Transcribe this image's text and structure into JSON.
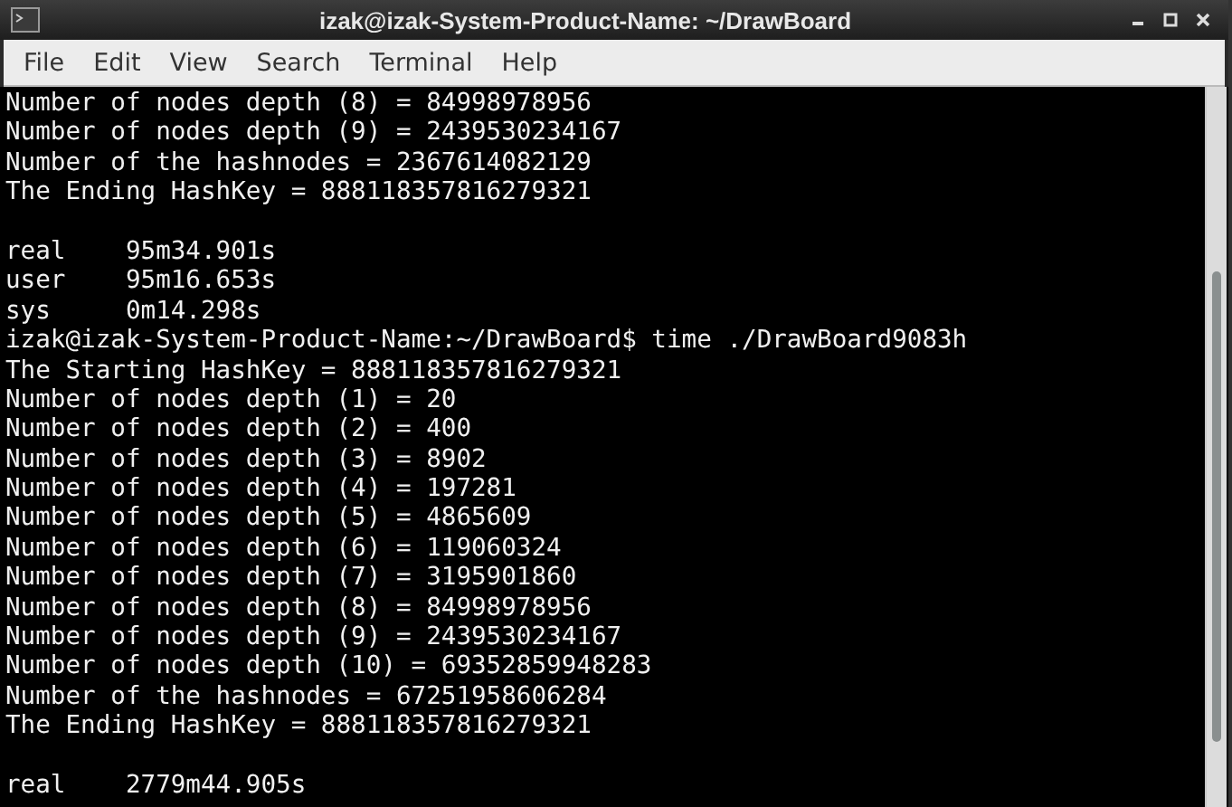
{
  "window": {
    "title": "izak@izak-System-Product-Name: ~/DrawBoard"
  },
  "menu": [
    "File",
    "Edit",
    "View",
    "Search",
    "Terminal",
    "Help"
  ],
  "terminal": {
    "lines": [
      {
        "kind": "text",
        "text": "Number of nodes depth (8) = 84998978956"
      },
      {
        "kind": "text",
        "text": "Number of nodes depth (9) = 2439530234167"
      },
      {
        "kind": "text",
        "text": "Number of the hashnodes = 2367614082129"
      },
      {
        "kind": "text",
        "text": "The Ending HashKey = 888118357816279321"
      },
      {
        "kind": "blank"
      },
      {
        "kind": "text",
        "text": "real    95m34.901s"
      },
      {
        "kind": "text",
        "text": "user    95m16.653s"
      },
      {
        "kind": "text",
        "text": "sys     0m14.298s"
      },
      {
        "kind": "text",
        "text": "izak@izak-System-Product-Name:~/DrawBoard$ time ./DrawBoard9083h"
      },
      {
        "kind": "text",
        "text": "The Starting HashKey = 888118357816279321"
      },
      {
        "kind": "text",
        "text": "Number of nodes depth (1) = 20"
      },
      {
        "kind": "text",
        "text": "Number of nodes depth (2) = 400"
      },
      {
        "kind": "text",
        "text": "Number of nodes depth (3) = 8902"
      },
      {
        "kind": "text",
        "text": "Number of nodes depth (4) = 197281"
      },
      {
        "kind": "text",
        "text": "Number of nodes depth (5) = 4865609"
      },
      {
        "kind": "text",
        "text": "Number of nodes depth (6) = 119060324"
      },
      {
        "kind": "text",
        "text": "Number of nodes depth (7) = 3195901860"
      },
      {
        "kind": "text",
        "text": "Number of nodes depth (8) = 84998978956"
      },
      {
        "kind": "text",
        "text": "Number of nodes depth (9) = 2439530234167"
      },
      {
        "kind": "text",
        "text": "Number of nodes depth (10) = 69352859948283"
      },
      {
        "kind": "text",
        "text": "Number of the hashnodes = 67251958606284"
      },
      {
        "kind": "text",
        "text": "The Ending HashKey = 888118357816279321"
      },
      {
        "kind": "blank"
      },
      {
        "kind": "text",
        "text": "real    2779m44.905s"
      }
    ]
  }
}
